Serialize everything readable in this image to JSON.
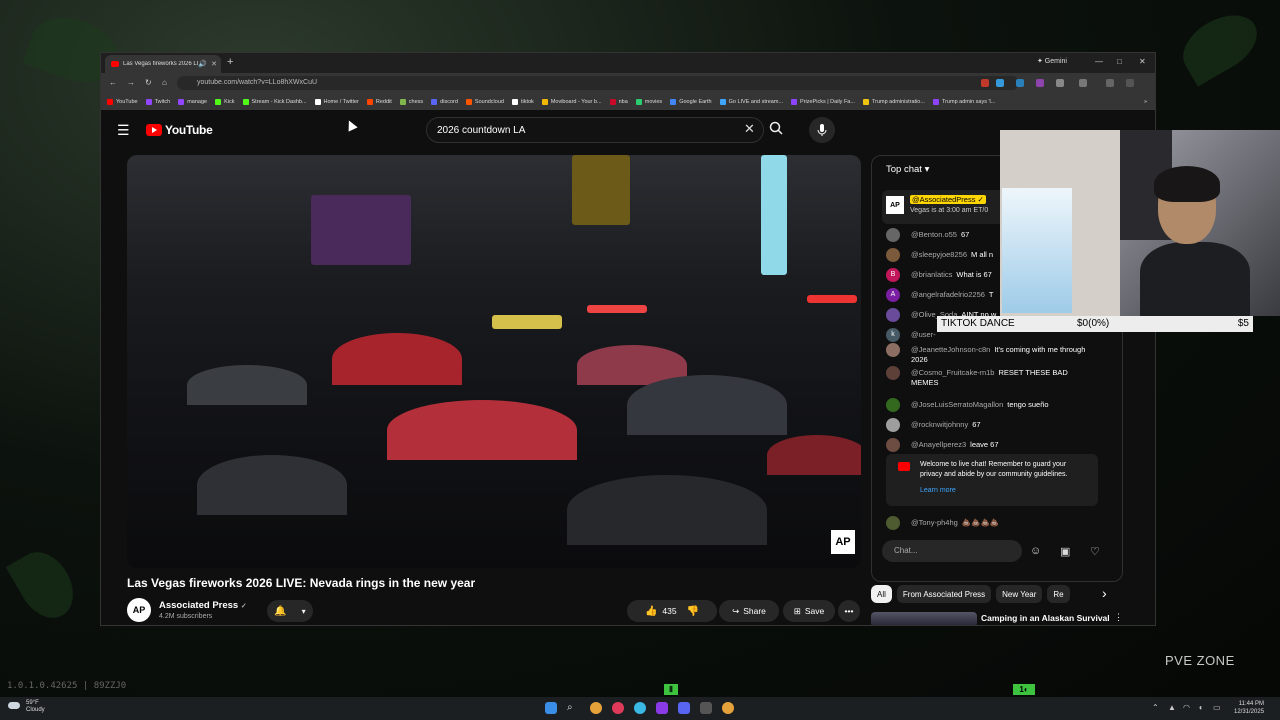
{
  "browser": {
    "tab_title": "Las Vegas fireworks 2026 LI",
    "new_tab": "+",
    "gemini": "✦ Gemini",
    "url": "youtube.com/watch?v=LLo8hXWxCuU",
    "window_controls": {
      "minimize": "—",
      "maximize": "□",
      "close": "✕"
    },
    "bookmarks": [
      {
        "label": "YouTube",
        "color": "#ff0000"
      },
      {
        "label": "Twitch",
        "color": "#9146ff"
      },
      {
        "label": "manage",
        "color": "#9146ff"
      },
      {
        "label": "Kick",
        "color": "#53fc18"
      },
      {
        "label": "Stream - Kick Dashb...",
        "color": "#53fc18"
      },
      {
        "label": "Home / Twitter",
        "color": "#ffffff"
      },
      {
        "label": "Reddit",
        "color": "#ff4500"
      },
      {
        "label": "chess",
        "color": "#81b64c"
      },
      {
        "label": "discord",
        "color": "#5865f2"
      },
      {
        "label": "Soundcloud",
        "color": "#ff5500"
      },
      {
        "label": "tiktok",
        "color": "#ffffff"
      },
      {
        "label": "Moviboard - Your b...",
        "color": "#f2b705"
      },
      {
        "label": "nba",
        "color": "#c9082a"
      },
      {
        "label": "movies",
        "color": "#2ecc71"
      },
      {
        "label": "Google Earth",
        "color": "#4285f4"
      },
      {
        "label": "Go LIVE and stream...",
        "color": "#3ea6ff"
      },
      {
        "label": "PrizePicks | Daily Fa...",
        "color": "#8e44ff"
      },
      {
        "label": "Trump administratio...",
        "color": "#f1c40f"
      },
      {
        "label": "Trump admin says 'l...",
        "color": "#8e44ff"
      }
    ],
    "bookmarks_more": "»"
  },
  "youtube": {
    "logo_text": "YouTube",
    "search_query": "2026 countdown LA",
    "video": {
      "watermark": "AP",
      "title": "Las Vegas fireworks 2026 LIVE: Nevada rings in the new year",
      "channel_name": "Associated Press",
      "verified": "✓",
      "subscribers": "4.2M subscribers",
      "channel_avatar": "AP",
      "likes": "435",
      "share_label": "Share",
      "save_label": "Save",
      "more": "•••"
    },
    "chat": {
      "header": "Top chat",
      "pinned": {
        "avatar": "AP",
        "user": "@AssociatedPress ✓",
        "text": "Vegas is at 3:00 am ET/0"
      },
      "messages": [
        {
          "avatar": "",
          "color": "#666",
          "user": "@Benton.o55",
          "text": "67"
        },
        {
          "avatar": "",
          "color": "#7a5a3a",
          "user": "@sleepyjoe8256",
          "text": "M all n"
        },
        {
          "avatar": "B",
          "color": "#c2185b",
          "user": "@brianlatics",
          "text": "What is 67"
        },
        {
          "avatar": "A",
          "color": "#7b1fa2",
          "user": "@angelrafadelrio2256",
          "text": "T"
        },
        {
          "avatar": "",
          "color": "#6a4a9a",
          "user": "@Olive_Soda",
          "text": "AINT no w"
        },
        {
          "avatar": "k",
          "color": "#455a64",
          "user": "@user-",
          "text": ""
        },
        {
          "avatar": "",
          "color": "#8d6e63",
          "user": "@JeanetteJohnson-c8n",
          "text": "It's coming with me through 2026"
        },
        {
          "avatar": "",
          "color": "#5d4037",
          "user": "@Cosmo_Fruitcake-m1b",
          "text": "RESET THESE BAD MEMES"
        },
        {
          "avatar": "",
          "color": "#33691e",
          "user": "@JoseLuisSerratoMagallon",
          "text": "tengo sueño"
        },
        {
          "avatar": "",
          "color": "#9e9e9e",
          "user": "@rocknwitjohnny",
          "text": "67"
        },
        {
          "avatar": "",
          "color": "#6d4c41",
          "user": "@Anayellperez3",
          "text": "leave 67"
        }
      ],
      "welcome_text": "Welcome to live chat! Remember to guard your privacy and abide by our community guidelines.",
      "learn_more": "Learn more",
      "last_message": {
        "avatar": "",
        "color": "#4e5b31",
        "user": "@Tony-ph4hg",
        "text": "💩💩💩💩"
      },
      "input_placeholder": "Chat...",
      "icons": {
        "emoji": "☺",
        "money": "▣",
        "heart": "♡"
      }
    },
    "chips": [
      "All",
      "From Associated Press",
      "New Year",
      "Re"
    ],
    "chips_next": "›",
    "recommendation_title": "Camping in an Alaskan Survival"
  },
  "overlay": {
    "tiktok_label": "TIKTOK DANCE",
    "tiktok_progress": "$0(0%)",
    "tiktok_goal": "$5",
    "zone_label": "PVE ZONE",
    "version": "1.0.1.0.42625 | 89ZZJ0"
  },
  "taskbar": {
    "temperature": "59°F",
    "condition": "Cloudy",
    "time": "11:44 PM",
    "date": "12/31/2025"
  }
}
